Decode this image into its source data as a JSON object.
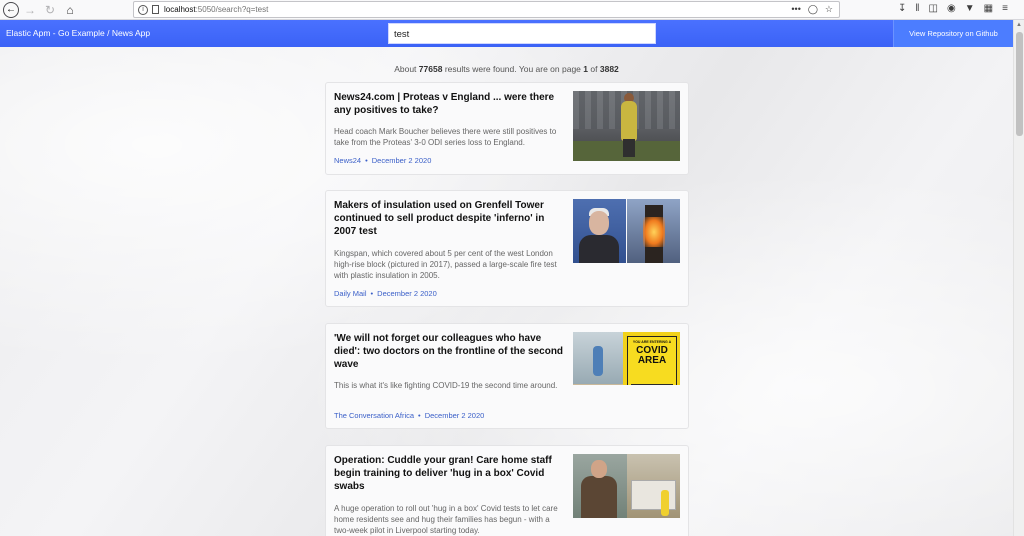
{
  "browser": {
    "url_host": "localhost",
    "url_path": ":5050/search?q=test",
    "actions_label": "•••"
  },
  "app": {
    "brand": "Elastic Apm - Go Example / News App",
    "search_value": "test",
    "repo_button": "View Repository on Github"
  },
  "results": {
    "prefix": "About",
    "count": "77658",
    "middle": "results were found. You are on page",
    "page": "1",
    "of": "of",
    "total_pages": "3882"
  },
  "articles": [
    {
      "title": "News24.com | Proteas v England ... were there any positives to take?",
      "description": "Head coach Mark Boucher believes there were still positives to take from the Proteas' 3-0 ODI series loss to England.",
      "source": "News24",
      "date": "December 2 2020"
    },
    {
      "title": "Makers of insulation used on Grenfell Tower continued to sell product despite 'inferno' in 2007 test",
      "description": "Kingspan, which covered about 5 per cent of the west London high-rise block (pictured in 2017), passed a large-scale fire test with plastic insulation in 2005.",
      "source": "Daily Mail",
      "date": "December 2 2020"
    },
    {
      "title": "'We will not forget our colleagues who have died': two doctors on the frontline of the second wave",
      "description": "This is what it's like fighting COVID-19 the second time around.",
      "source": "The Conversation Africa",
      "date": "December 2 2020",
      "image_text": {
        "line1": "YOU ARE ENTERING A",
        "main": "COVID AREA"
      }
    },
    {
      "title": "Operation: Cuddle your gran! Care home staff begin training to deliver 'hug in a box' Covid swabs",
      "description": "A huge operation to roll out 'hug in a box' Covid tests to let care home residents see and hug their families has begun - with a two-week pilot in Liverpool starting today.",
      "source": "",
      "date": ""
    }
  ],
  "colors": {
    "navbar": "#3b62f6",
    "link": "#3a5fc8"
  }
}
